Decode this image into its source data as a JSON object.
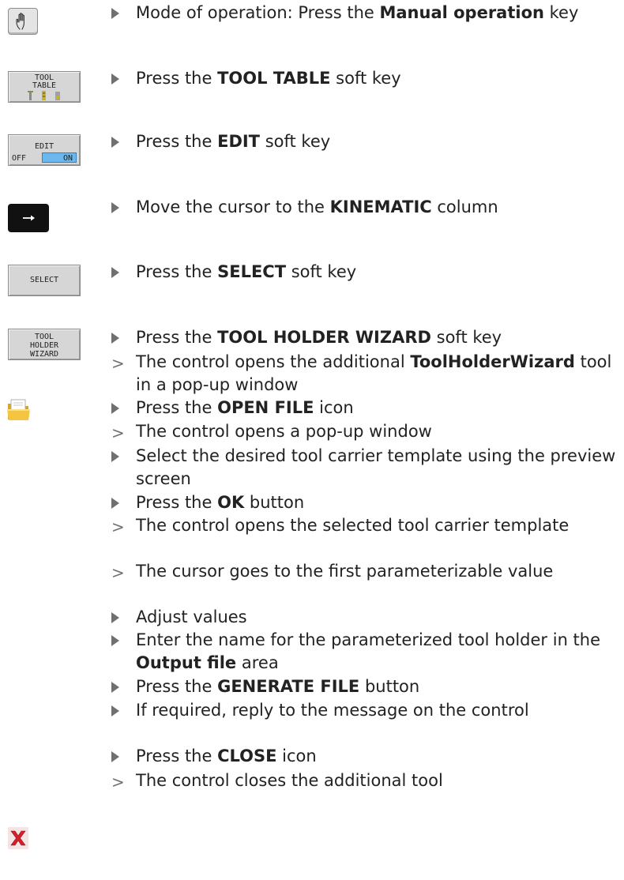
{
  "softkeys": {
    "tool_table_line1": "TOOL",
    "tool_table_line2": "TABLE",
    "edit_top": "EDIT",
    "edit_off": "OFF",
    "edit_on": "ON",
    "select": "SELECT",
    "wizard_line1": "TOOL",
    "wizard_line2": "HOLDER",
    "wizard_line3": "WIZARD"
  },
  "icons": [
    "manual-operation-hand-key",
    "arrow-right-key",
    "open-file-folder-icon",
    "close-x-icon"
  ],
  "steps": [
    {
      "kind": "action",
      "pre": "Mode of operation: Press the ",
      "bold": "Manual operation",
      "post": " key"
    },
    {
      "kind": "action",
      "pre": "Press the ",
      "bold": "TOOL TABLE",
      "post": " soft key"
    },
    {
      "kind": "action",
      "pre": "Press the ",
      "bold": "EDIT",
      "post": " soft key"
    },
    {
      "kind": "action",
      "pre": "Move the cursor to the ",
      "bold": "KINEMATIC",
      "post": " column"
    },
    {
      "kind": "action",
      "pre": "Press the ",
      "bold": "SELECT",
      "post": " soft key"
    },
    {
      "kind": "action",
      "pre": "Press the ",
      "bold": "TOOL HOLDER WIZARD",
      "post": " soft key"
    },
    {
      "kind": "result",
      "pre": "The control opens the additional ",
      "bold": "ToolHolderWizard",
      "post": " tool in a pop-up window"
    },
    {
      "kind": "action",
      "pre": "Press the ",
      "bold": "OPEN FILE",
      "post": " icon"
    },
    {
      "kind": "result",
      "pre": "The control opens a pop-up window",
      "bold": "",
      "post": ""
    },
    {
      "kind": "action",
      "pre": "Select the desired tool carrier template using the preview screen",
      "bold": "",
      "post": ""
    },
    {
      "kind": "action",
      "pre": "Press the ",
      "bold": "OK",
      "post": " button"
    },
    {
      "kind": "result",
      "pre": "The control opens the selected tool carrier template",
      "bold": "",
      "post": ""
    },
    {
      "kind": "result",
      "pre": "The cursor goes to the first parameterizable value",
      "bold": "",
      "post": ""
    },
    {
      "kind": "action",
      "pre": "Adjust values",
      "bold": "",
      "post": ""
    },
    {
      "kind": "action",
      "pre": "Enter the name for the parameterized tool holder in the ",
      "bold": "Output file",
      "post": " area"
    },
    {
      "kind": "action",
      "pre": "Press the ",
      "bold": "GENERATE FILE",
      "post": " button"
    },
    {
      "kind": "action",
      "pre": "If required, reply to the message on the control",
      "bold": "",
      "post": ""
    },
    {
      "kind": "action",
      "pre": "Press the ",
      "bold": "CLOSE",
      "post": " icon"
    },
    {
      "kind": "result",
      "pre": "The control closes the additional tool",
      "bold": "",
      "post": ""
    }
  ]
}
